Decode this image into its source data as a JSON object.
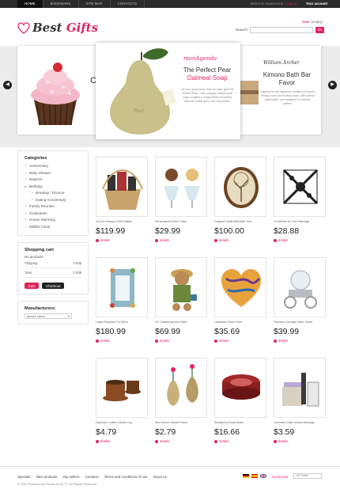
{
  "topnav": {
    "items": [
      "HOME",
      "BOOKMARK",
      "SITE MAP",
      "CONTACTS"
    ],
    "welcome": "Welcome Anonymous",
    "login": "( Log in )",
    "account": "Your account"
  },
  "logo": {
    "part1": "Best ",
    "part2": "Gifts"
  },
  "cart_mini": {
    "label": "Cart:",
    "value": "(empty)"
  },
  "search": {
    "label": "Search",
    "go": "Go"
  },
  "slider": {
    "prev_icon": "arrow-left-icon",
    "next_icon": "arrow-right-icon",
    "slide_center": {
      "brand": "monAgenda",
      "title_line1": "The Perfect Pear",
      "title_line2": "Oatmeal Soap",
      "desc": "Let your guest know that you care, give the \"Perfect Pear.\" This uniquely shaped pear soap contains a unique blend of natural oatmeal, wheat germ and shea butter."
    },
    "slide_right": {
      "signature": "William Archer",
      "title": "Kimono Bath Bar Favor",
      "desc": "Inspired by the Japanese tradition of kimono design, each bar is hand-made, with natural shea butter, and wrapped in a kimono pattern."
    },
    "slide_left": {
      "peek": "C"
    }
  },
  "categories": {
    "heading": "Categories",
    "items": [
      {
        "label": "Anniversary",
        "sub": false,
        "open": false
      },
      {
        "label": "Baby Shower",
        "sub": false,
        "open": false
      },
      {
        "label": "Baptism",
        "sub": false,
        "open": false
      },
      {
        "label": "Birthday",
        "sub": false,
        "open": true
      },
      {
        "label": "Breakup / Divorce",
        "sub": true,
        "open": false
      },
      {
        "label": "Dating Anniversary",
        "sub": true,
        "open": false
      },
      {
        "label": "Family Reunion",
        "sub": false,
        "open": false
      },
      {
        "label": "Graduation",
        "sub": false,
        "open": false
      },
      {
        "label": "House Warming",
        "sub": false,
        "open": false
      },
      {
        "label": "Midlife Crisis",
        "sub": false,
        "open": false
      }
    ]
  },
  "cart": {
    "heading": "Shopping cart",
    "empty": "No products",
    "shipping_label": "Shipping",
    "shipping_value": "0.00$",
    "total_label": "Total",
    "total_value": "0.00$",
    "cart_btn": "Cart",
    "checkout_btn": "Checkout"
  },
  "manufacturers": {
    "heading": "Manufacturers:",
    "select": "please select"
  },
  "products": [
    {
      "name": "You Are Always A Gift Basket",
      "price": "$119.99",
      "details": "details"
    },
    {
      "name": "Personalized Wine Glass",
      "price": "$29.99",
      "details": "details"
    },
    {
      "name": "Original Family Birthdate Tree",
      "price": "$100.00",
      "details": "details"
    },
    {
      "name": "12 Wishes for Your Marriage",
      "price": "$28.88",
      "details": "details"
    },
    {
      "name": "Large Recycled Tin Mirror",
      "price": "$180.99",
      "details": "details"
    },
    {
      "name": "10\" Gardening Mom Bear",
      "price": "$69.99",
      "details": "details"
    },
    {
      "name": "Lattebeat Glass Heart",
      "price": "$35.69",
      "details": "details"
    },
    {
      "name": "Princess Carriage Silver Globe",
      "price": "$39.99",
      "details": "details"
    },
    {
      "name": "Espresso Coffee Candle Cup",
      "price": "$4.79",
      "details": "details"
    },
    {
      "name": "Mini Woven Sachet Favor",
      "price": "$2.79",
      "details": "details"
    },
    {
      "name": "Strawberry Body Butter",
      "price": "$16.66",
      "details": "details"
    },
    {
      "name": "Lavender Cake Deluxe Message",
      "price": "$3.59",
      "details": "details"
    }
  ],
  "footer": {
    "links": [
      "Specials",
      "New products",
      "Top sellers",
      "Contacts",
      "Terms and conditions of use",
      "About us"
    ],
    "copyright": "© 2011 Powered by Presta Shop ™. All Rights Reserved",
    "currency_label": "Currencies",
    "currency_select": "US Dollar"
  },
  "colors": {
    "accent": "#e0245e",
    "topbar": "#2b2b2b",
    "slider_bg": "#ececec"
  }
}
